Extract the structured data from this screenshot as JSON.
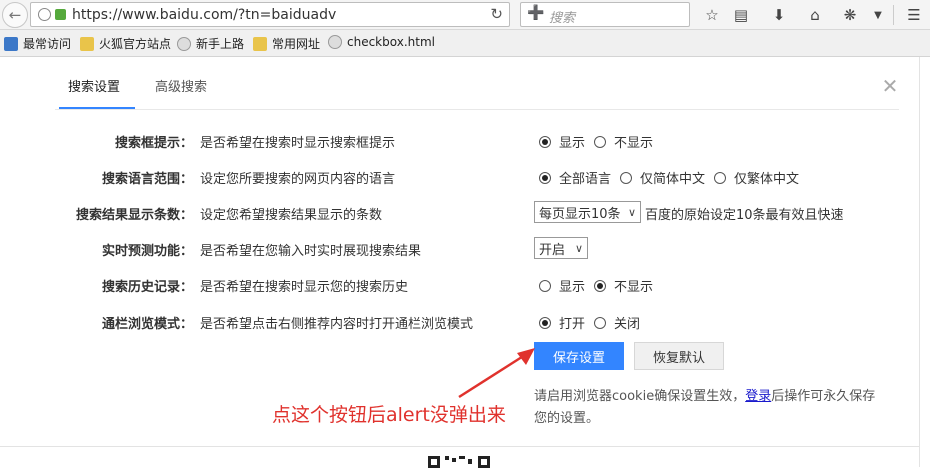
{
  "browser": {
    "url": "https://www.baidu.com/?tn=baiduadv",
    "search_placeholder": "搜索",
    "bookmarks": [
      {
        "label": "最常访问",
        "icon": "star-folder-icon"
      },
      {
        "label": "火狐官方站点",
        "icon": "folder-icon"
      },
      {
        "label": "新手上路",
        "icon": "globe-icon"
      },
      {
        "label": "常用网址",
        "icon": "folder-icon"
      },
      {
        "label": "checkbox.html",
        "icon": "globe-icon"
      }
    ]
  },
  "tabs": [
    {
      "label": "搜索设置",
      "active": true
    },
    {
      "label": "高级搜索",
      "active": false
    }
  ],
  "settings": {
    "suggest": {
      "label": "搜索框提示：",
      "desc": "是否希望在搜索时显示搜索框提示",
      "options": [
        "显示",
        "不显示"
      ],
      "selected": "显示"
    },
    "language": {
      "label": "搜索语言范围：",
      "desc": "设定您所要搜索的网页内容的语言",
      "options": [
        "全部语言",
        "仅简体中文",
        "仅繁体中文"
      ],
      "selected": "全部语言"
    },
    "result_count": {
      "label": "搜索结果显示条数：",
      "desc": "设定您希望搜索结果显示的条数",
      "value": "每页显示10条",
      "hint": "百度的原始设定10条最有效且快速"
    },
    "realtime": {
      "label": "实时预测功能：",
      "desc": "是否希望在您输入时实时展现搜索结果",
      "value": "开启"
    },
    "history": {
      "label": "搜索历史记录：",
      "desc": "是否希望在搜索时显示您的搜索历史",
      "options": [
        "显示",
        "不显示"
      ],
      "selected": "不显示"
    },
    "browse_mode": {
      "label": "通栏浏览模式：",
      "desc": "是否希望点击右侧推荐内容时打开通栏浏览模式",
      "options": [
        "打开",
        "关闭"
      ],
      "selected": "打开"
    }
  },
  "buttons": {
    "save": "保存设置",
    "reset": "恢复默认"
  },
  "note": {
    "before": "请启用浏览器cookie确保设置生效，",
    "link": "登录",
    "after": "后操作可永久保存您的设置。"
  },
  "annotation": "点这个按钮后alert没弹出来",
  "colors": {
    "accent": "#3385ff",
    "annotation": "#e0322d"
  }
}
